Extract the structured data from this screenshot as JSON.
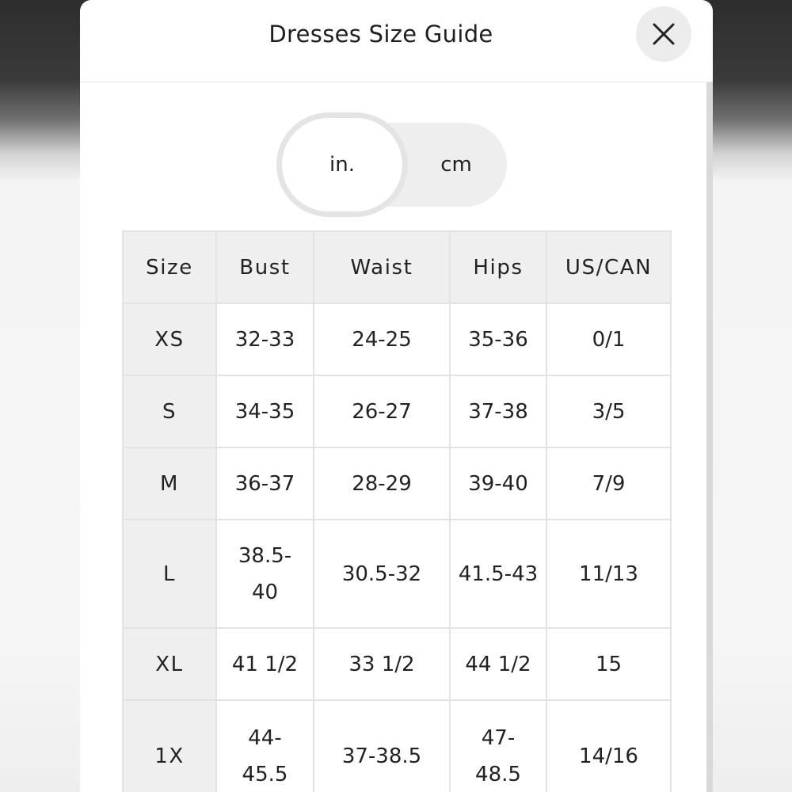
{
  "modal": {
    "title": "Dresses Size Guide",
    "close_icon": "close-icon"
  },
  "unit_toggle": {
    "options": [
      "in.",
      "cm"
    ],
    "selected": "in."
  },
  "table": {
    "headers": [
      "Size",
      "Bust",
      "Waist",
      "Hips",
      "US/CAN"
    ],
    "rows": [
      [
        "XS",
        "32-33",
        "24-25",
        "35-36",
        "0/1"
      ],
      [
        "S",
        "34-35",
        "26-27",
        "37-38",
        "3/5"
      ],
      [
        "M",
        "36-37",
        "28-29",
        "39-40",
        "7/9"
      ],
      [
        "L",
        "38.5-\n40",
        "30.5-32",
        "41.5-43",
        "11/13"
      ],
      [
        "XL",
        "41 1/2",
        "33 1/2",
        "44 1/2",
        "15"
      ],
      [
        "1X",
        "44-\n45.5",
        "37-38.5",
        "47-\n48.5",
        "14/16"
      ]
    ]
  }
}
